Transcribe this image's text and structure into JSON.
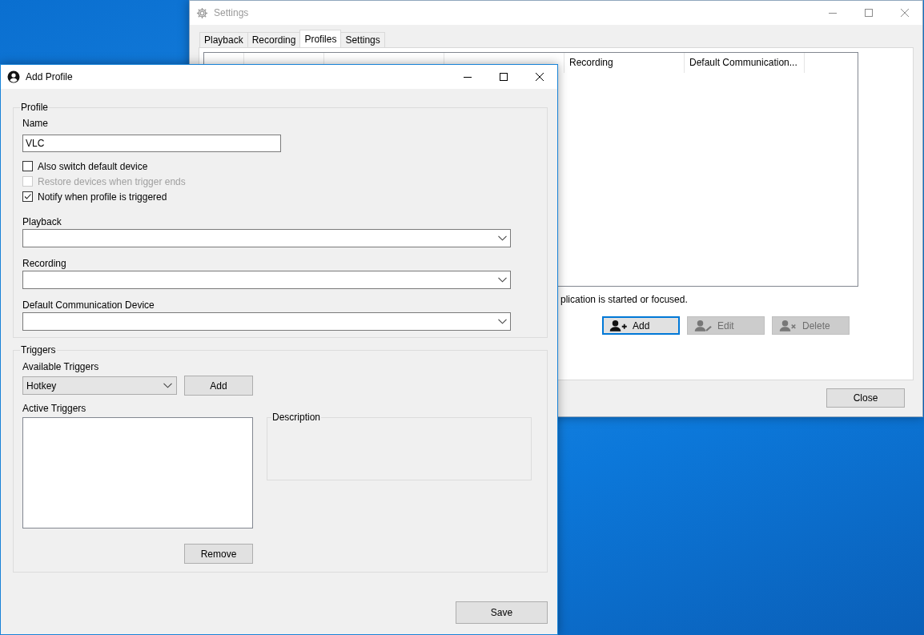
{
  "settings_window": {
    "title": "Settings",
    "tabs": [
      {
        "label": "Playback",
        "selected": false
      },
      {
        "label": "Recording",
        "selected": false
      },
      {
        "label": "Profiles",
        "selected": true
      },
      {
        "label": "Settings",
        "selected": false
      }
    ],
    "table": {
      "columns": [
        "Recording",
        "Default Communication..."
      ]
    },
    "hint": "plication is started or focused.",
    "buttons": [
      {
        "label": "Add",
        "kind": "add",
        "disabled": false,
        "focused": true
      },
      {
        "label": "Edit",
        "kind": "edit",
        "disabled": true,
        "focused": false
      },
      {
        "label": "Delete",
        "kind": "delete",
        "disabled": true,
        "focused": false
      }
    ],
    "close_button": "Close"
  },
  "add_profile_window": {
    "title": "Add Profile",
    "profile_group": {
      "title": "Profile",
      "name_label": "Name",
      "name_value": "VLC",
      "options": [
        {
          "label": "Also switch default device",
          "checked": false,
          "disabled": false
        },
        {
          "label": "Restore devices when trigger ends",
          "checked": false,
          "disabled": true
        },
        {
          "label": "Notify when profile is triggered",
          "checked": true,
          "disabled": false
        }
      ],
      "dropdowns": [
        {
          "label": "Playback"
        },
        {
          "label": "Recording"
        },
        {
          "label": "Default Communication Device"
        }
      ]
    },
    "triggers_group": {
      "title": "Triggers",
      "available_label": "Available Triggers",
      "available_value": "Hotkey",
      "add_button": "Add",
      "active_label": "Active Triggers",
      "description_title": "Description",
      "remove_button": "Remove"
    },
    "save_button": "Save"
  }
}
